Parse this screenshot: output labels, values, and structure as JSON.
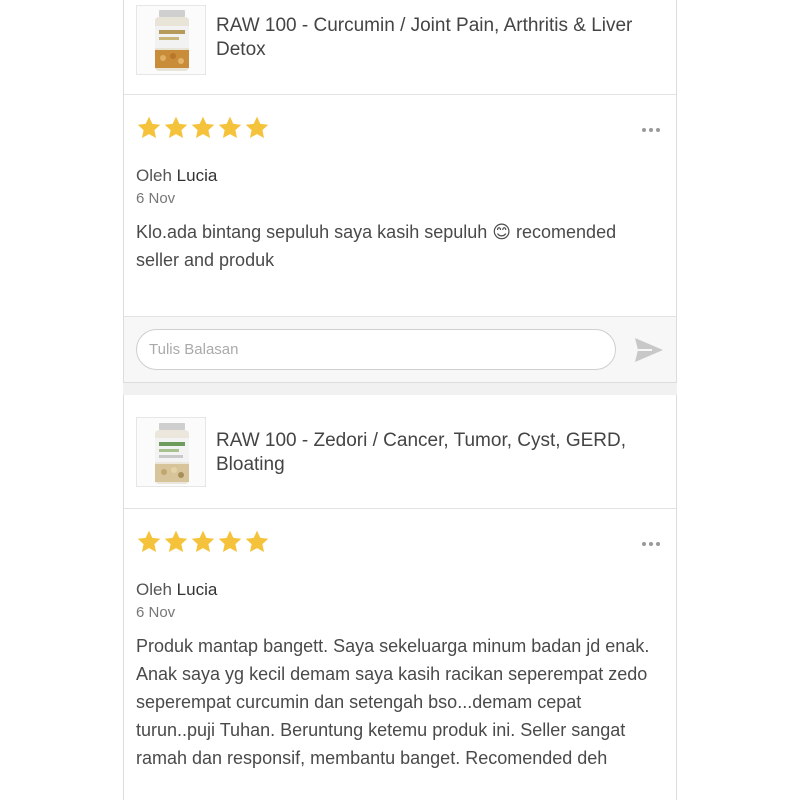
{
  "reviews": [
    {
      "product": {
        "name": "RAW 100 - Curcumin / Joint Pain, Arthritis & Liver Detox"
      },
      "rating": 5,
      "by_prefix": "Oleh",
      "author": "Lucia",
      "date": "6 Nov",
      "text": "Klo.ada bintang sepuluh saya kasih sepuluh 😊 recomended seller and produk",
      "reply_placeholder": "Tulis Balasan"
    },
    {
      "product": {
        "name": "RAW 100 - Zedori / Cancer, Tumor, Cyst, GERD, Bloating"
      },
      "rating": 5,
      "by_prefix": "Oleh",
      "author": "Lucia",
      "date": "6 Nov",
      "text": "Produk mantap bangett. Saya sekeluarga minum badan jd enak. Anak saya yg kecil demam saya kasih racikan seperempat zedo seperempat curcumin dan setengah bso...demam cepat turun..puji Tuhan. Beruntung ketemu produk ini. Seller sangat ramah dan responsif, membantu banget. Recomended deh"
    }
  ],
  "colors": {
    "star": "#f5c33b",
    "send": "#c8c8c8"
  },
  "icons": [
    "product-thumbnail",
    "star-icon",
    "more-options-icon",
    "send-icon"
  ]
}
